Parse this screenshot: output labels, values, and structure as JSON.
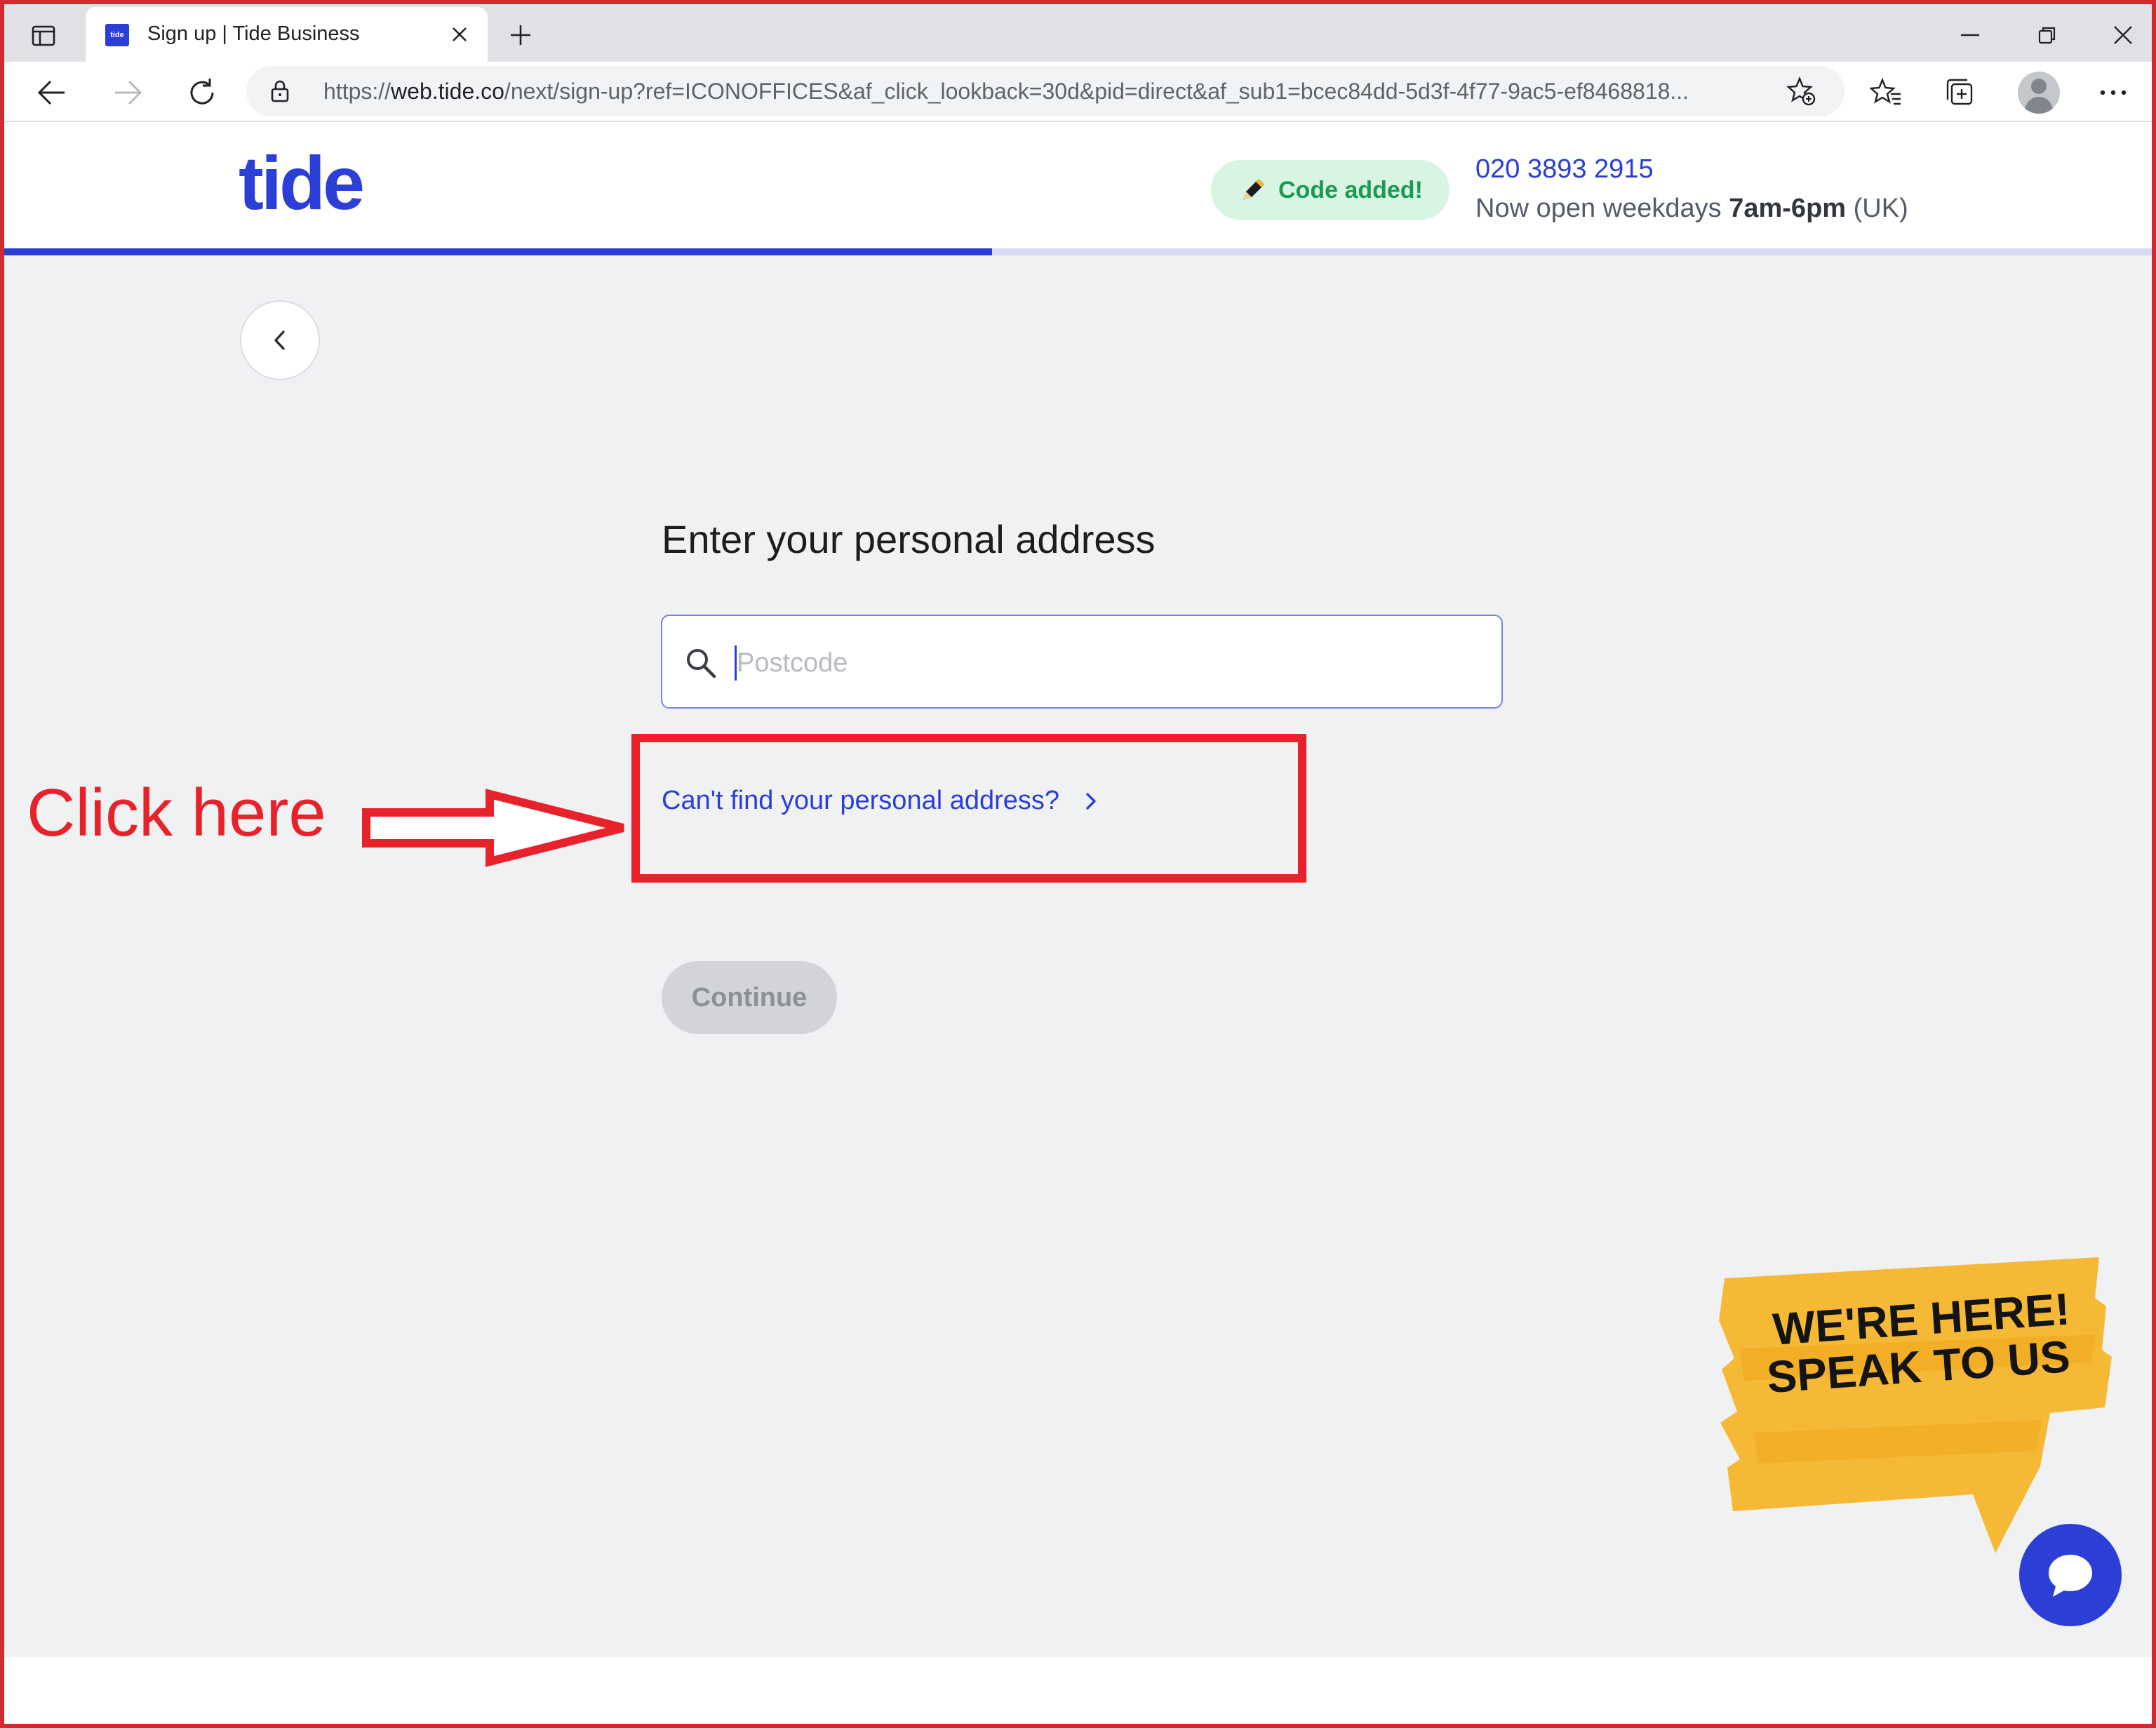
{
  "browser": {
    "tab_title": "Sign up | Tide Business",
    "tab_favicon_text": "tide",
    "url_prefix": "https://",
    "url_host": "web.tide.co",
    "url_rest": "/next/sign-up?ref=ICONOFFICES&af_click_lookback=30d&pid=direct&af_sub1=bcec84dd-5d3f-4f77-9ac5-ef8468818...",
    "icons": [
      "tab-actions-icon",
      "close-icon",
      "plus-icon",
      "minimize-icon",
      "restore-icon",
      "close-window-icon",
      "back-arrow-icon",
      "forward-arrow-icon",
      "refresh-icon",
      "lock-icon",
      "add-favorite-icon",
      "favorites-icon",
      "collections-icon",
      "profile-icon",
      "more-icon"
    ]
  },
  "header": {
    "logo": "tide",
    "code_badge": "Code added!",
    "phone": "020 3893 2915",
    "hours_prefix": "Now open weekdays ",
    "hours_bold": "7am-6pm",
    "hours_suffix": " (UK)",
    "signup_progress_percent": 46
  },
  "form": {
    "heading": "Enter your personal address",
    "postcode_placeholder": "Postcode",
    "postcode_value": "",
    "cant_find_link": "Can't find your personal address?",
    "continue_label": "Continue",
    "continue_enabled": false
  },
  "promo": {
    "sticker_line1": "WE'RE HERE!",
    "sticker_line2": "SPEAK TO US"
  },
  "annotation": {
    "text": "Click here",
    "color": "#e8222a"
  },
  "colors": {
    "brand": "#2b3ed6",
    "badge_bg": "#d8f5e3",
    "badge_text": "#1b9a55",
    "sticker": "#f6b52b"
  }
}
